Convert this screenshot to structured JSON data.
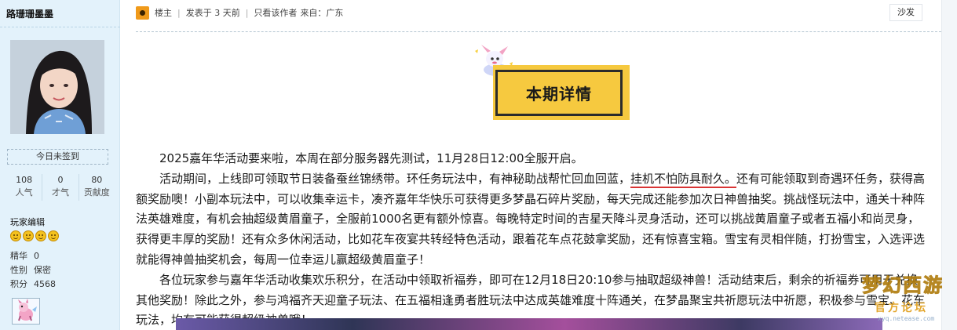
{
  "user": {
    "username": "路珊珊墨墨",
    "checkin_label": "今日未签到",
    "stats": [
      {
        "value": "108",
        "label": "人气"
      },
      {
        "value": "0",
        "label": "才气"
      },
      {
        "value": "80",
        "label": "贡献度"
      }
    ],
    "medals_title": "玩家编辑",
    "info": [
      {
        "key": "精华",
        "value": "0"
      },
      {
        "key": "性别",
        "value": "保密"
      },
      {
        "key": "积分",
        "value": "4568"
      }
    ]
  },
  "post": {
    "role": "楼主",
    "posted": "发表于 3 天前",
    "author_only": "只看该作者",
    "from": "来自：广东",
    "floor": "沙发",
    "title": "本期详情",
    "paragraphs": [
      "2025嘉年华活动要来啦，本周在部分服务器先测试，11月28日12:00全服开启。",
      {
        "pre": "活动期间，上线即可领取节日装备蚕丝锦绣带。环任务玩法中，有神秘助战帮忙回血回蓝，",
        "hl": "挂机不怕防具耐久。",
        "post": "还有可能领取到奇遇环任务，获得高额奖励噢！小副本玩法中，可以收集幸运卡，凑齐嘉年华快乐可获得更多梦晶石碎片奖励，每天完成还能参加次日神兽抽奖。挑战怪玩法中，通关十种阵法英雄难度，有机会抽超级黄眉童子，全服前1000名更有额外惊喜。每晚特定时间的吉星天降斗灵身活动，还可以挑战黄眉童子或者五福小和尚灵身，获得更丰厚的奖励！还有众多休闲活动，比如花车夜宴共转经特色活动，跟着花车点花鼓拿奖励，还有惊喜宝箱。雪宝有灵相伴随，打扮雪宝，入选评选就能得神兽抽奖机会，每周一位幸运儿赢超级黄眉童子！"
      },
      "各位玩家参与嘉年华活动收集欢乐积分，在活动中领取祈福券，即可在12月18日20:10参与抽取超级神兽！活动结束后，剩余的祈福券可用于兑换其他奖励！除此之外，参与鸿福齐天迎童子玩法、在五福相逢勇者胜玩法中达成英雄难度十阵通关，在梦晶聚宝共祈愿玩法中祈愿，积极参与雪宝、花车玩法，均有可能获得超级神兽哦！"
    ]
  },
  "watermark": {
    "main": "梦幻西游",
    "sub": "官方论坛",
    "url": "xyq.netease.com"
  },
  "colors": {
    "sidebar_bg": "#e3f2fb",
    "title_card": "#f6c93f",
    "highlight_underline": "#d93434"
  }
}
